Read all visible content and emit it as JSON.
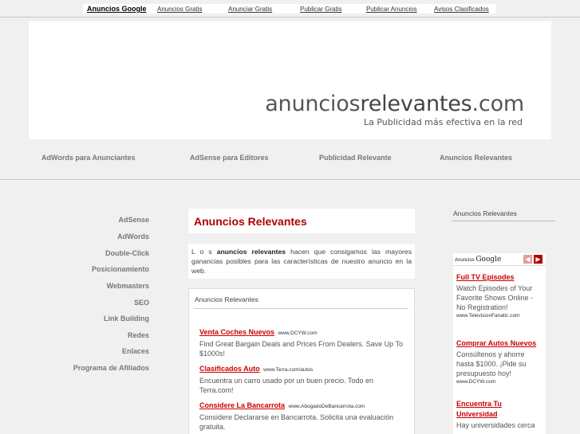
{
  "topbar": {
    "links": [
      "Anuncios Google",
      "Anuncios Gratis",
      "Anunciar Gratis",
      "Publicar Gratis",
      "Publicar Anuncios",
      "Avisos Clasificados"
    ]
  },
  "header": {
    "logo_part1": "anuncios",
    "logo_part2": "relevantes",
    "logo_part3": ".com",
    "tagline": "La Publicidad más efectiva en la red"
  },
  "nav": [
    "AdWords para Anunciantes",
    "AdSense para Editores",
    "Publicidad Relevante",
    "Anuncios Relevantes"
  ],
  "left_nav": [
    "AdSense",
    "AdWords",
    "Double-Click",
    "Posicionamiento",
    "Webmasters",
    "SEO",
    "Link Building",
    "Redes",
    "Enlaces",
    "Programa de Afiliados"
  ],
  "main": {
    "title": "Anuncios Relevantes",
    "intro_prefix": "L o s ",
    "intro_bold": "anuncios relevantes",
    "intro_rest": " hacen que consigamos las mayores ganancias posibles para las características de nuestro anuncio en la web.",
    "ads_header": "Anuncios Relevantes",
    "ads": [
      {
        "title": "Venta Coches Nuevos",
        "url": "www.DCYW.com",
        "desc": "Find Great Bargain Deals and Prices From Dealers. Save Up To $1000s!"
      },
      {
        "title": "Clasificados Auto",
        "url": "www.Terra.com/autos",
        "desc": "Encuentra un carro usado por un buen precio. Todo en Terra.com!"
      },
      {
        "title": "Considere La Bancarrota",
        "url": "www.AbogadoDeBancarrota.com",
        "desc": "Considere Declararse en Bancarrota. Solicita una evaluación gratuita."
      }
    ]
  },
  "right": {
    "title": "Anuncios Relevantes",
    "google_label_small": "Anuncios",
    "google_label_brand": "Google",
    "ads": [
      {
        "title": "Full TV Episodes",
        "desc": "Watch Episodes of Your Favorite Shows Online - No Registration!",
        "url": "www.TelevisionFanatic.com"
      },
      {
        "title": "Comprar Autos Nuevos",
        "desc": "Consúltenos y ahorre hasta $1000. ¡Pide su presupuesto hoy!",
        "url": "www.DCYW.com"
      },
      {
        "title": "Encuentra Tu Universidad",
        "desc": "Hay universidades cerca",
        "url": ""
      }
    ]
  },
  "icons": {
    "prev": "chevron-left-icon",
    "next": "chevron-right-icon"
  },
  "colors": {
    "accent": "#b00000",
    "link_red": "#cc0000",
    "page_bg": "#f0f0f0"
  }
}
